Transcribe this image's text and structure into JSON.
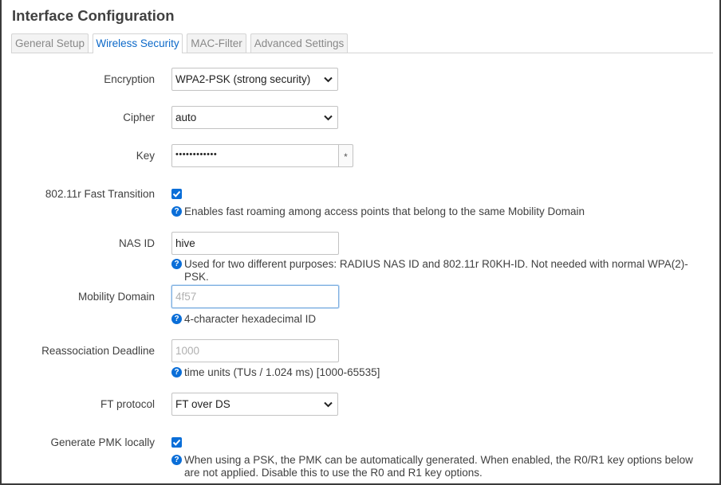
{
  "page": {
    "title": "Interface Configuration"
  },
  "tabs": [
    {
      "label": "General Setup",
      "active": false
    },
    {
      "label": "Wireless Security",
      "active": true
    },
    {
      "label": "MAC-Filter",
      "active": false
    },
    {
      "label": "Advanced Settings",
      "active": false
    }
  ],
  "form": {
    "encryption": {
      "label": "Encryption",
      "value": "WPA2-PSK (strong security)"
    },
    "cipher": {
      "label": "Cipher",
      "value": "auto"
    },
    "key": {
      "label": "Key",
      "masked_value": "••••••••••••",
      "reveal_glyph": "*"
    },
    "fast_transition": {
      "label": "802.11r Fast Transition",
      "checked": true,
      "help": "Enables fast roaming among access points that belong to the same Mobility Domain"
    },
    "nas_id": {
      "label": "NAS ID",
      "value": "hive",
      "help": "Used for two different purposes: RADIUS NAS ID and 802.11r R0KH-ID. Not needed with normal WPA(2)-PSK."
    },
    "mobility_domain": {
      "label": "Mobility Domain",
      "placeholder": "4f57",
      "help": "4-character hexadecimal ID"
    },
    "reassoc_deadline": {
      "label": "Reassociation Deadline",
      "placeholder": "1000",
      "help": "time units (TUs / 1.024 ms) [1000-65535]"
    },
    "ft_protocol": {
      "label": "FT protocol",
      "value": "FT over DS"
    },
    "pmk_local": {
      "label": "Generate PMK locally",
      "checked": true,
      "help": "When using a PSK, the PMK can be automatically generated. When enabled, the R0/R1 key options below are not applied. Disable this to use the R0 and R1 key options."
    }
  },
  "icons": {
    "help": "help-circle-icon",
    "dropdown": "chevron-down-icon",
    "check": "checkmark-icon"
  },
  "help_glyph": "?",
  "colors": {
    "accent": "#0a6ed8",
    "active_tab_text": "#0c69c9",
    "text": "#404040"
  }
}
